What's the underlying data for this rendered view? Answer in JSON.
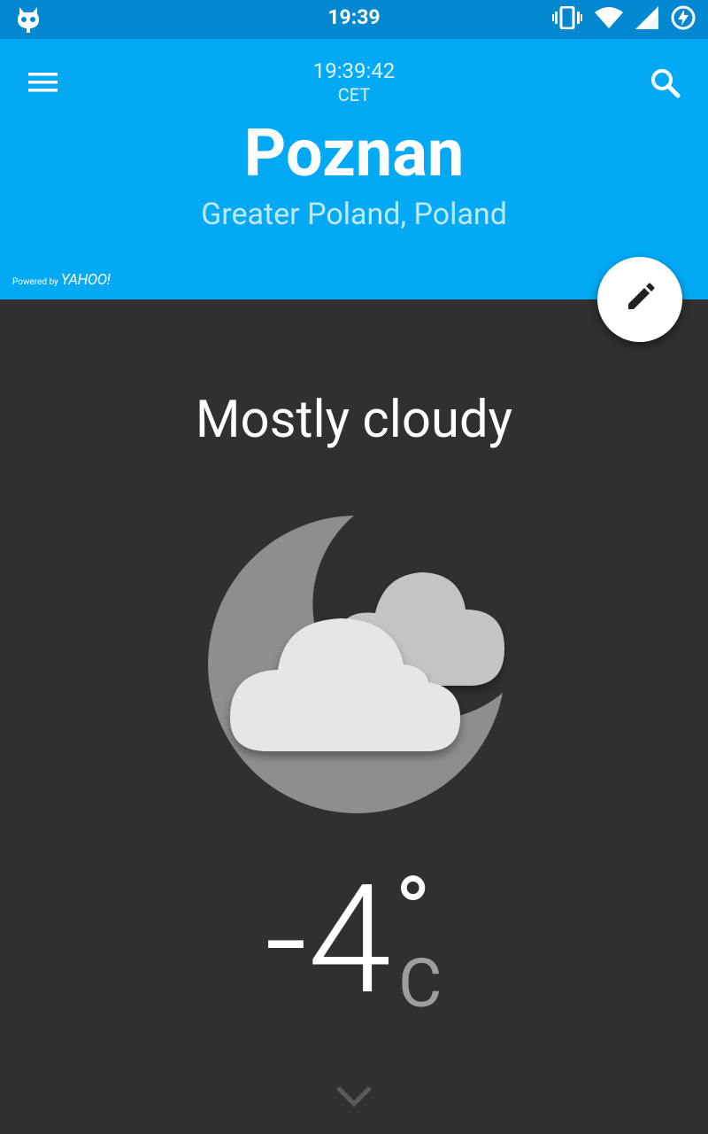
{
  "status_bar": {
    "time": "19:39",
    "icons": [
      "cyanogen-bot-icon",
      "vibrate-icon",
      "wifi-icon",
      "cell-signal-icon",
      "battery-charging-icon"
    ]
  },
  "header": {
    "clock": "19:39:42",
    "timezone": "CET",
    "city": "Poznan",
    "region": "Greater Poland, Poland",
    "powered_by": "Powered by",
    "powered_brand": "YAHOO!",
    "menu_icon": "hamburger-menu-icon",
    "search_icon": "search-icon",
    "background_color": "#03A9F4",
    "statusbar_color": "#0288D1"
  },
  "fab": {
    "icon": "edit-pencil-icon"
  },
  "weather": {
    "condition": "Mostly cloudy",
    "icon": "moon-with-clouds-icon",
    "temperature": "-4",
    "degree_symbol": "°",
    "unit": "C"
  },
  "footer": {
    "expand_icon": "chevron-down-icon"
  },
  "colors": {
    "background": "#303030",
    "unit_text": "#9E9E9E"
  }
}
